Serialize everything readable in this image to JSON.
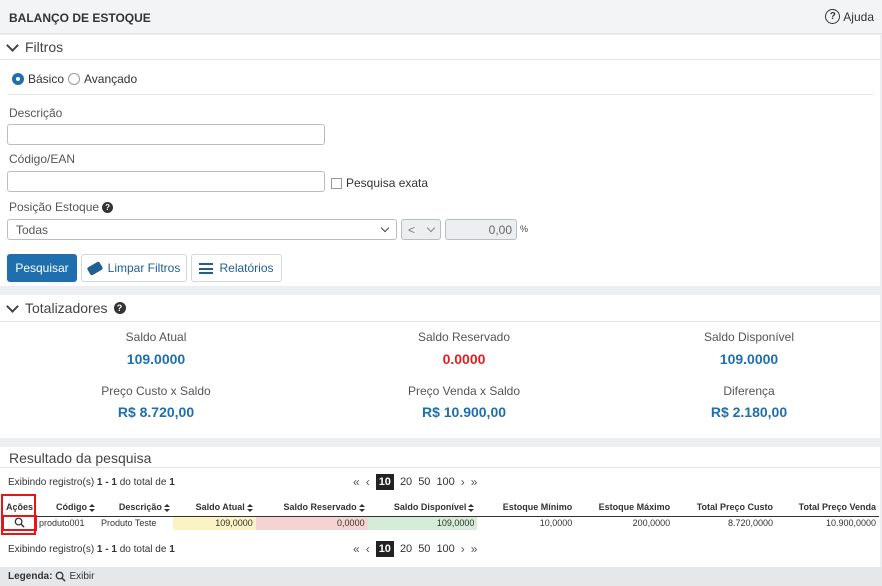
{
  "header": {
    "title": "BALANÇO DE ESTOQUE",
    "help_label": "Ajuda"
  },
  "filters": {
    "title": "Filtros",
    "mode_basic": "Básico",
    "mode_advanced": "Avançado",
    "description_label": "Descrição",
    "description_value": "",
    "code_label": "Código/EAN",
    "code_value": "",
    "exact_label": "Pesquisa exata",
    "position_label": "Posição Estoque",
    "position_value": "Todas",
    "operator_value": "<",
    "amount_value": "0,00",
    "percent": "%",
    "search_button": "Pesquisar",
    "clear_button": "Limpar Filtros",
    "reports_button": "Relatórios"
  },
  "totals": {
    "title": "Totalizadores",
    "items": [
      {
        "label": "Saldo Atual",
        "value": "109.0000"
      },
      {
        "label": "Saldo Reservado",
        "value": "0.0000"
      },
      {
        "label": "Saldo Disponível",
        "value": "109.0000"
      },
      {
        "label": "Preço Custo x Saldo",
        "value": "R$ 8.720,00"
      },
      {
        "label": "Preço Venda x Saldo",
        "value": "R$ 10.900,00"
      },
      {
        "label": "Diferença",
        "value": "R$ 2.180,00"
      }
    ]
  },
  "results": {
    "title": "Resultado da pesquisa",
    "showing_prefix": "Exibindo registro(s) ",
    "showing_range": "1 - 1",
    "showing_mid": " do total de ",
    "showing_total": "1",
    "page_sizes": [
      "10",
      "20",
      "50",
      "100"
    ],
    "columns": [
      "Ações",
      "Código",
      "Descrição",
      "Saldo Atual",
      "Saldo Reservado",
      "Saldo Disponível",
      "Estoque Mínimo",
      "Estoque Máximo",
      "Total Preço Custo",
      "Total Preço Venda"
    ],
    "rows": [
      {
        "code": "produto001",
        "description": "Produto Teste",
        "saldo_atual": "109,0000",
        "saldo_reservado": "0,0000",
        "saldo_disponivel": "109,0000",
        "estoque_minimo": "10,0000",
        "estoque_maximo": "200,0000",
        "total_custo": "8.720,0000",
        "total_venda": "10.900,0000"
      }
    ],
    "legend_label": "Legenda:",
    "legend_view": "Exibir"
  },
  "colors": {
    "primary": "#1f6fae",
    "negative": "#e02020",
    "highlight": "#e01818",
    "yellow_cell": "#fbf3c4",
    "red_cell": "#f5d3d3",
    "green_cell": "#d5ecd7"
  }
}
